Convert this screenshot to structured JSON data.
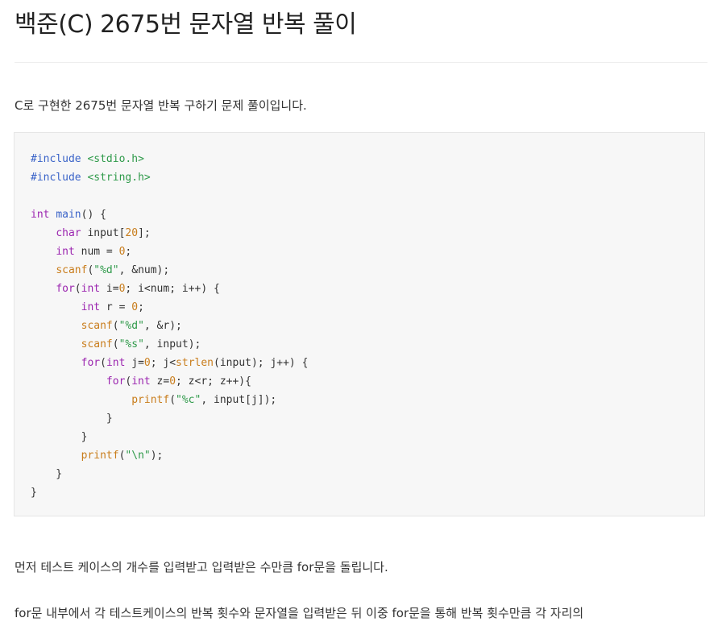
{
  "post": {
    "title": "백준(C) 2675번 문자열 반복 풀이",
    "intro": "C로 구현한 2675번 문자열 반복 구하기 문제 풀이입니다.",
    "paragraph1": "먼저 테스트 케이스의 개수를 입력받고 입력받은 수만큼 for문을 돌립니다.",
    "paragraph2": "for문 내부에서 각 테스트케이스의 반복 횟수와 문자열을 입력받은 뒤 이중 for문을 통해 반복 횟수만큼 각 자리의"
  },
  "code": {
    "lines": [
      [
        {
          "t": "#include",
          "c": "pre"
        },
        {
          "t": " "
        },
        {
          "t": "<stdio.h>",
          "c": "str"
        }
      ],
      [
        {
          "t": "#include",
          "c": "pre"
        },
        {
          "t": " "
        },
        {
          "t": "<string.h>",
          "c": "str"
        }
      ],
      [],
      [
        {
          "t": "int",
          "c": "kw"
        },
        {
          "t": " "
        },
        {
          "t": "main",
          "c": "main"
        },
        {
          "t": "() {"
        }
      ],
      [
        {
          "t": "    "
        },
        {
          "t": "char",
          "c": "kw"
        },
        {
          "t": " input["
        },
        {
          "t": "20",
          "c": "num"
        },
        {
          "t": "];"
        }
      ],
      [
        {
          "t": "    "
        },
        {
          "t": "int",
          "c": "kw"
        },
        {
          "t": " num = "
        },
        {
          "t": "0",
          "c": "num"
        },
        {
          "t": ";"
        }
      ],
      [
        {
          "t": "    "
        },
        {
          "t": "scanf",
          "c": "fn"
        },
        {
          "t": "("
        },
        {
          "t": "\"%d\"",
          "c": "str"
        },
        {
          "t": ", &num);"
        }
      ],
      [
        {
          "t": "    "
        },
        {
          "t": "for",
          "c": "kw"
        },
        {
          "t": "("
        },
        {
          "t": "int",
          "c": "kw"
        },
        {
          "t": " i="
        },
        {
          "t": "0",
          "c": "num"
        },
        {
          "t": "; i<num; i++) {"
        }
      ],
      [
        {
          "t": "        "
        },
        {
          "t": "int",
          "c": "kw"
        },
        {
          "t": " r = "
        },
        {
          "t": "0",
          "c": "num"
        },
        {
          "t": ";"
        }
      ],
      [
        {
          "t": "        "
        },
        {
          "t": "scanf",
          "c": "fn"
        },
        {
          "t": "("
        },
        {
          "t": "\"%d\"",
          "c": "str"
        },
        {
          "t": ", &r);"
        }
      ],
      [
        {
          "t": "        "
        },
        {
          "t": "scanf",
          "c": "fn"
        },
        {
          "t": "("
        },
        {
          "t": "\"%s\"",
          "c": "str"
        },
        {
          "t": ", input);"
        }
      ],
      [
        {
          "t": "        "
        },
        {
          "t": "for",
          "c": "kw"
        },
        {
          "t": "("
        },
        {
          "t": "int",
          "c": "kw"
        },
        {
          "t": " j="
        },
        {
          "t": "0",
          "c": "num"
        },
        {
          "t": "; j<"
        },
        {
          "t": "strlen",
          "c": "fn"
        },
        {
          "t": "(input); j++) {"
        }
      ],
      [
        {
          "t": "            "
        },
        {
          "t": "for",
          "c": "kw"
        },
        {
          "t": "("
        },
        {
          "t": "int",
          "c": "kw"
        },
        {
          "t": " z="
        },
        {
          "t": "0",
          "c": "num"
        },
        {
          "t": "; z<r; z++){"
        }
      ],
      [
        {
          "t": "                "
        },
        {
          "t": "printf",
          "c": "fn"
        },
        {
          "t": "("
        },
        {
          "t": "\"%c\"",
          "c": "str"
        },
        {
          "t": ", input[j]);"
        }
      ],
      [
        {
          "t": "            }"
        }
      ],
      [
        {
          "t": "        }"
        }
      ],
      [
        {
          "t": "        "
        },
        {
          "t": "printf",
          "c": "fn"
        },
        {
          "t": "("
        },
        {
          "t": "\"\\n\"",
          "c": "str"
        },
        {
          "t": ");"
        }
      ],
      [
        {
          "t": "    }"
        }
      ],
      [
        {
          "t": "}"
        }
      ]
    ]
  },
  "colors": {
    "keyword": "#9c27b0",
    "preprocessor": "#3a63c8",
    "string": "#2f9a4a",
    "function": "#c97d1c",
    "number": "#c97d1c",
    "code_background": "#f7f7f7"
  }
}
